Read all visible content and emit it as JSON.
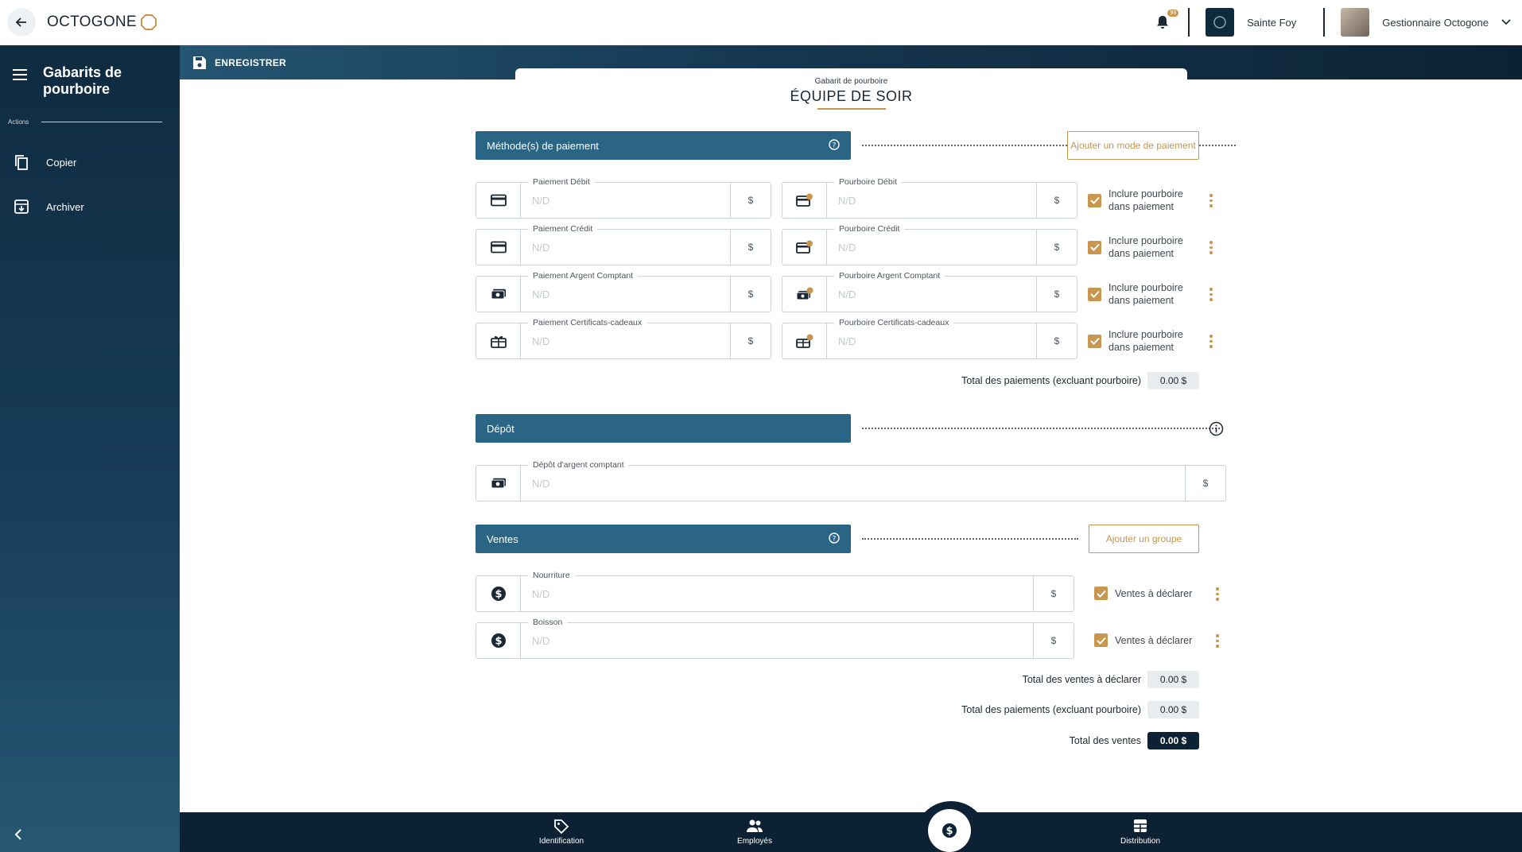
{
  "app": {
    "logo_text": "OCTOGONE"
  },
  "header": {
    "notification_count": "99",
    "store_name": "Sainte Foy",
    "user_name": "Gestionnaire Octogone"
  },
  "sidebar": {
    "title": "Gabarits de pourboire",
    "actions_label": "Actions",
    "items": [
      {
        "label": "Copier",
        "icon": "copy-icon"
      },
      {
        "label": "Archiver",
        "icon": "archive-icon"
      }
    ]
  },
  "toolbar": {
    "save_label": "ENREGISTRER"
  },
  "page": {
    "subtitle": "Gabarit de pourboire",
    "title": "ÉQUIPE DE SOIR"
  },
  "payment_section": {
    "title": "Méthode(s) de paiement",
    "add_button": "Ajouter un mode de paiement",
    "rows": [
      {
        "pay_label": "Paiement Débit",
        "pay_value": "N/D",
        "pay_icon": "credit-card-icon",
        "tip_label": "Pourboire Débit",
        "tip_value": "N/D",
        "tip_icon": "card-tip-icon",
        "unit": "$",
        "check_label": "Inclure pourboire dans paiement",
        "checked": true
      },
      {
        "pay_label": "Paiement Crédit",
        "pay_value": "N/D",
        "pay_icon": "credit-card-icon",
        "tip_label": "Pourboire Crédit",
        "tip_value": "N/D",
        "tip_icon": "card-tip-icon",
        "unit": "$",
        "check_label": "Inclure pourboire dans paiement",
        "checked": true
      },
      {
        "pay_label": "Paiement Argent Comptant",
        "pay_value": "N/D",
        "pay_icon": "cash-icon",
        "tip_label": "Pourboire Argent Comptant",
        "tip_value": "N/D",
        "tip_icon": "cash-tip-icon",
        "unit": "$",
        "check_label": "Inclure pourboire dans paiement",
        "checked": true
      },
      {
        "pay_label": "Paiement Certificats-cadeaux",
        "pay_value": "N/D",
        "pay_icon": "gift-card-icon",
        "tip_label": "Pourboire Certificats-cadeaux",
        "tip_value": "N/D",
        "tip_icon": "gift-tip-icon",
        "unit": "$",
        "check_label": "Inclure pourboire dans paiement",
        "checked": true
      }
    ],
    "total_label": "Total des paiements (excluant pourboire)",
    "total_value": "0.00 $"
  },
  "deposit_section": {
    "title": "Dépôt",
    "field_label": "Dépôt d'argent comptant",
    "field_value": "N/D",
    "unit": "$"
  },
  "sales_section": {
    "title": "Ventes",
    "add_button": "Ajouter un groupe",
    "rows": [
      {
        "label": "Nourriture",
        "value": "N/D",
        "unit": "$",
        "check_label": "Ventes à déclarer",
        "checked": true
      },
      {
        "label": "Boisson",
        "value": "N/D",
        "unit": "$",
        "check_label": "Ventes à déclarer",
        "checked": true
      }
    ],
    "totals": [
      {
        "label": "Total des ventes à déclarer",
        "value": "0.00 $"
      },
      {
        "label": "Total des paiements (excluant pourboire)",
        "value": "0.00 $"
      },
      {
        "label": "Total des ventes",
        "value": "0.00 $"
      }
    ]
  },
  "bottom_nav": {
    "items": [
      {
        "label": "Identification",
        "icon": "tag-icon"
      },
      {
        "label": "Employés",
        "icon": "people-icon"
      },
      {
        "label": "Distribution",
        "icon": "grid-icon"
      }
    ],
    "center_icon": "dollar-icon"
  },
  "colors": {
    "accent": "#c8964f",
    "primary": "#2b6586",
    "dark": "#0c2234"
  }
}
